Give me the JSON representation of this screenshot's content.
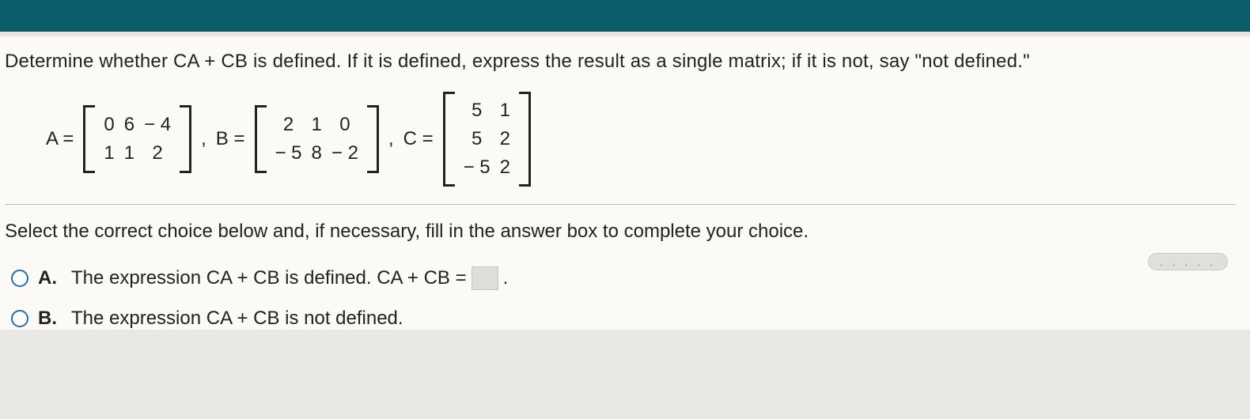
{
  "question": "Determine whether CA + CB is defined. If it is defined, express the result as a single matrix; if it is not, say \"not defined.\"",
  "matrices": {
    "A": {
      "label": "A =",
      "rows": 2,
      "cols": 3,
      "cells": [
        "0",
        "6",
        "− 4",
        "1",
        "1",
        "2"
      ]
    },
    "sep_ab": ", ",
    "B": {
      "label": "B =",
      "rows": 2,
      "cols": 3,
      "cells": [
        "2",
        "1",
        "0",
        "− 5",
        "8",
        "− 2"
      ]
    },
    "sep_bc": ", ",
    "C": {
      "label": "C =",
      "rows": 3,
      "cols": 2,
      "cells": [
        "5",
        "1",
        "5",
        "2",
        "− 5",
        "2"
      ]
    }
  },
  "dots": ". . . . .",
  "instruction": "Select the correct choice below and, if necessary, fill in the answer box to complete your choice.",
  "choices": {
    "A": {
      "letter": "A.",
      "text_before": "The expression CA + CB is defined. CA + CB =",
      "text_after": "."
    },
    "B": {
      "letter": "B.",
      "text": "The expression CA + CB is not defined."
    }
  },
  "chart_data": {
    "type": "table",
    "title": "Matrix definitions for CA + CB problem",
    "matrices": {
      "A": [
        [
          0,
          6,
          -4
        ],
        [
          1,
          1,
          2
        ]
      ],
      "B": [
        [
          2,
          1,
          0
        ],
        [
          -5,
          8,
          -2
        ]
      ],
      "C": [
        [
          5,
          1
        ],
        [
          5,
          2
        ],
        [
          -5,
          2
        ]
      ]
    }
  }
}
